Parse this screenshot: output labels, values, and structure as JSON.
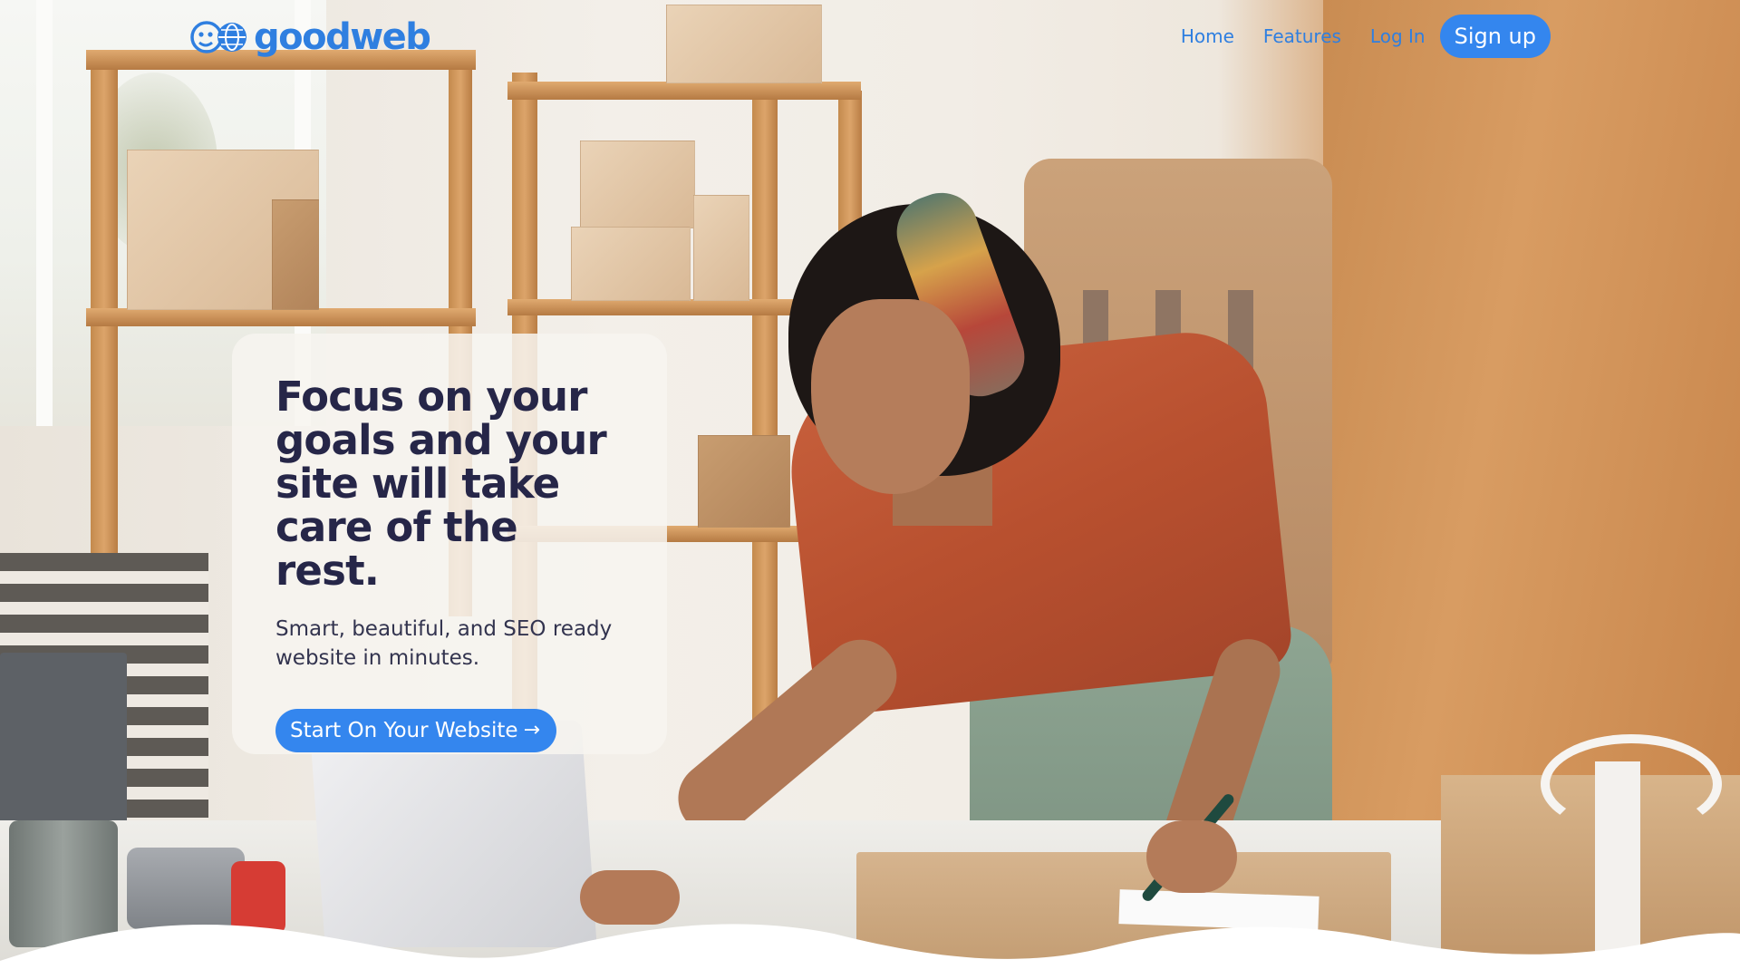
{
  "brand": {
    "name": "goodweb",
    "accent_color": "#3486ee",
    "logo_icon": "face-globe-icon"
  },
  "nav": {
    "links": [
      {
        "label": "Home"
      },
      {
        "label": "Features"
      },
      {
        "label": "Log In"
      }
    ],
    "signup_label": "Sign up"
  },
  "hero": {
    "title": "Focus on your goals and your site will take care of the rest.",
    "subtitle": "Smart, beautiful, and SEO ready website in minutes.",
    "cta_label": "Start On Your Website",
    "cta_icon": "arrow-right-icon",
    "heading_color": "#262648"
  },
  "background": {
    "description_icon": "hero-photo"
  }
}
